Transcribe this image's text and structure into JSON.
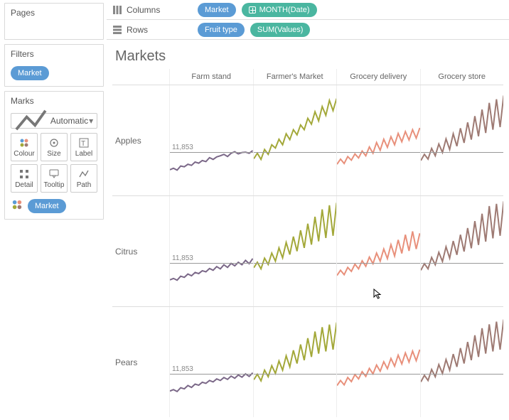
{
  "sidebar": {
    "pages_title": "Pages",
    "filters_title": "Filters",
    "filter_pill": "Market",
    "marks_title": "Marks",
    "marks_select": "Automatic",
    "buttons": {
      "colour": "Colour",
      "size": "Size",
      "label": "Label",
      "detail": "Detail",
      "tooltip": "Tooltip",
      "path": "Path"
    },
    "marks_legend_pill": "Market"
  },
  "shelves": {
    "columns_label": "Columns",
    "columns_pills": {
      "market": "Market",
      "month": "MONTH(Date)"
    },
    "rows_label": "Rows",
    "rows_pills": {
      "fruit": "Fruit type",
      "sum": "SUM(Values)"
    }
  },
  "viz": {
    "title": "Markets",
    "columns": [
      "Farm stand",
      "Farmer's Market",
      "Grocery delivery",
      "Grocery store"
    ],
    "rows": [
      "Apples",
      "Citrus",
      "Pears"
    ],
    "reference_label": "11,853",
    "colors": {
      "Farm stand": "#7b6888",
      "Farmer's Market": "#a3a839",
      "Grocery delivery": "#e8907b",
      "Grocery store": "#9e7a73"
    }
  },
  "chart_data": {
    "type": "line",
    "note": "Small-multiples trellis. Four markets (columns) by three fruit types (rows). X is month of date over ~60 points. Y is SUM(Values). A constant reference line at 11,853 is drawn in the first column of each row.",
    "ylim_approx": [
      0,
      30000
    ],
    "reference_value": 11853,
    "panels": [
      {
        "row": "Apples",
        "col": "Farm stand",
        "trend": "low-noise around 7000-12000, slight rise",
        "sample": [
          7000,
          7400,
          6900,
          8000,
          7800,
          8500,
          8200,
          9100,
          8800,
          9500,
          9200,
          10300,
          9800,
          10500,
          10800,
          11200,
          10600,
          11500,
          11900,
          11300,
          11700,
          11800,
          11500,
          12200
        ]
      },
      {
        "row": "Apples",
        "col": "Farmer's Market",
        "trend": "rising strongly 10000-26000 with spikes",
        "sample": [
          10000,
          11500,
          9800,
          12500,
          11200,
          13800,
          12900,
          15300,
          13800,
          16800,
          15200,
          17900,
          16500,
          19200,
          17900,
          21000,
          19400,
          22800,
          20300,
          24200,
          21800,
          25900,
          23100,
          26400
        ]
      },
      {
        "row": "Apples",
        "col": "Grocery delivery",
        "trend": "noisy rise 8000-18000",
        "sample": [
          8500,
          9900,
          8700,
          10600,
          9600,
          11300,
          10200,
          12100,
          10800,
          13200,
          11500,
          14400,
          12300,
          15300,
          13100,
          16000,
          13800,
          16900,
          14600,
          17400,
          15100,
          17900,
          15600,
          18400
        ]
      },
      {
        "row": "Apples",
        "col": "Grocery store",
        "trend": "noisy rise 9000-27000",
        "sample": [
          9500,
          11200,
          9900,
          12800,
          10800,
          14000,
          11700,
          15400,
          12500,
          16800,
          13400,
          18300,
          14300,
          19900,
          15200,
          21600,
          16100,
          23400,
          17000,
          25200,
          17900,
          26200,
          18600,
          27200
        ]
      },
      {
        "row": "Citrus",
        "col": "Farm stand",
        "trend": "low-noise 7000-13000 slight rise",
        "sample": [
          7200,
          7600,
          7100,
          8200,
          7900,
          8800,
          8300,
          9200,
          8900,
          9700,
          9400,
          10300,
          9800,
          10800,
          10200,
          11300,
          10600,
          11700,
          11000,
          12000,
          11300,
          12500,
          11600,
          13000
        ]
      },
      {
        "row": "Citrus",
        "col": "Farmer's Market",
        "trend": "rising strongly 10000-28000",
        "sample": [
          10500,
          12000,
          10200,
          13100,
          11400,
          14500,
          12300,
          15900,
          13200,
          17400,
          14100,
          19000,
          15000,
          20700,
          15900,
          22500,
          16800,
          24400,
          17700,
          26400,
          18600,
          27500,
          19200,
          28200
        ]
      },
      {
        "row": "Citrus",
        "col": "Grocery delivery",
        "trend": "noisy rise 8000-20000 late spike",
        "sample": [
          8400,
          9800,
          8600,
          10600,
          9500,
          11500,
          10200,
          12400,
          10900,
          13400,
          11600,
          14500,
          12300,
          15600,
          13000,
          16800,
          13700,
          18100,
          14400,
          19500,
          15100,
          20400,
          15600,
          19900
        ]
      },
      {
        "row": "Citrus",
        "col": "Grocery store",
        "trend": "noisy rise 9000-28000",
        "sample": [
          9800,
          11600,
          10200,
          13300,
          11300,
          14700,
          12200,
          16200,
          13100,
          17800,
          14000,
          19500,
          14900,
          21300,
          15800,
          23200,
          16700,
          25200,
          17600,
          27300,
          18500,
          27900,
          19200,
          28600
        ]
      },
      {
        "row": "Pears",
        "col": "Farm stand",
        "trend": "low-noise 7000-12000",
        "sample": [
          7100,
          7500,
          7000,
          8000,
          7700,
          8600,
          8100,
          9000,
          8700,
          9500,
          9200,
          10000,
          9600,
          10400,
          10000,
          10800,
          10300,
          11200,
          10600,
          11500,
          10900,
          11800,
          11100,
          12100
        ]
      },
      {
        "row": "Pears",
        "col": "Farmer's Market",
        "trend": "rising 10000-25000",
        "sample": [
          10200,
          11700,
          9900,
          12800,
          11000,
          14000,
          11900,
          15300,
          12800,
          16700,
          13700,
          18200,
          14600,
          19800,
          15500,
          21500,
          16400,
          23300,
          17300,
          24500,
          17900,
          25200,
          18400,
          25800
        ]
      },
      {
        "row": "Pears",
        "col": "Grocery delivery",
        "trend": "noisy rise 8000-18000",
        "sample": [
          8600,
          10000,
          8800,
          10800,
          9700,
          11600,
          10400,
          12400,
          11100,
          13300,
          11800,
          14200,
          12500,
          15100,
          13200,
          16000,
          13900,
          16900,
          14500,
          17500,
          15000,
          18000,
          15400,
          18400
        ]
      },
      {
        "row": "Pears",
        "col": "Grocery store",
        "trend": "noisy rise 9000-26000",
        "sample": [
          9600,
          11400,
          10000,
          13000,
          11000,
          14300,
          11900,
          15700,
          12800,
          17200,
          13700,
          18800,
          14600,
          20500,
          15500,
          22300,
          16400,
          24200,
          17300,
          25300,
          17900,
          26000,
          18400,
          26600
        ]
      }
    ]
  }
}
